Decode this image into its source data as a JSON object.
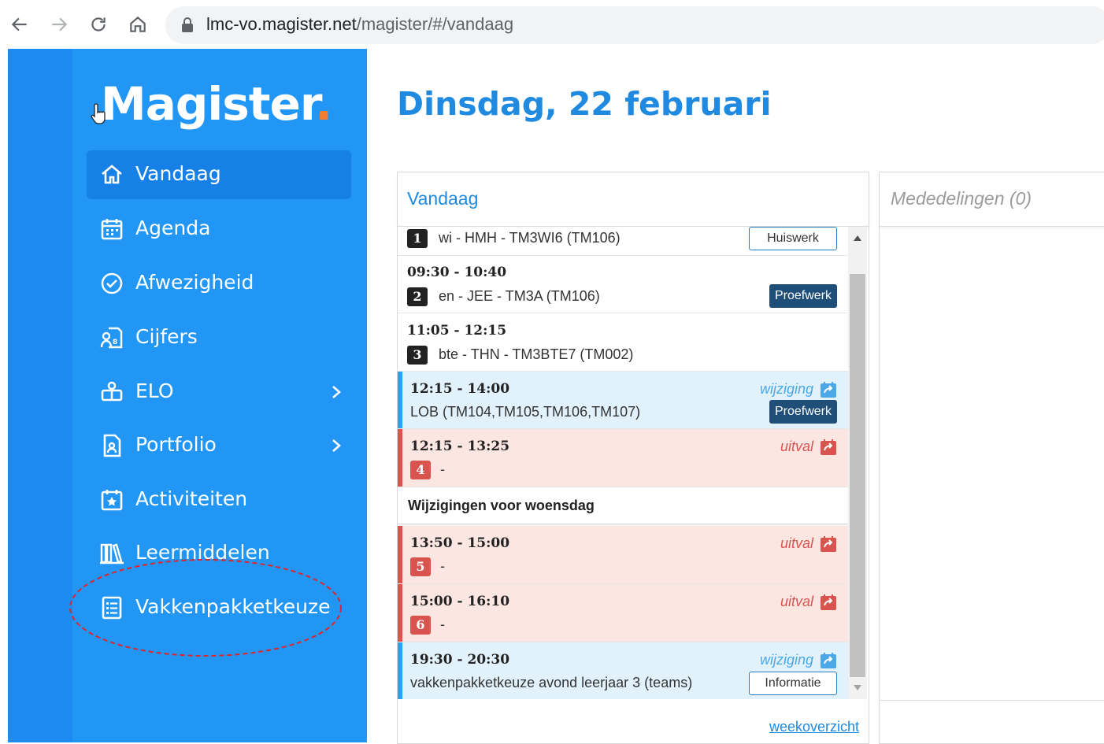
{
  "browser": {
    "url_host": "lmc-vo.magister.net",
    "url_path": "/magister/#/vandaag"
  },
  "app": {
    "logo": "Magister",
    "logo_dot": "."
  },
  "sidebar": {
    "items": [
      {
        "label": "Vandaag",
        "icon": "home-icon",
        "active": true
      },
      {
        "label": "Agenda",
        "icon": "calendar-icon"
      },
      {
        "label": "Afwezigheid",
        "icon": "check-circle-icon"
      },
      {
        "label": "Cijfers",
        "icon": "grades-icon"
      },
      {
        "label": "ELO",
        "icon": "elo-icon",
        "has_submenu": true
      },
      {
        "label": "Portfolio",
        "icon": "portfolio-icon",
        "has_submenu": true
      },
      {
        "label": "Activiteiten",
        "icon": "activity-calendar-icon"
      },
      {
        "label": "Leermiddelen",
        "icon": "books-icon"
      },
      {
        "label": "Vakkenpakketkeuze",
        "icon": "list-icon",
        "highlighted": true
      }
    ]
  },
  "main": {
    "title": "Dinsdag, 22 februari",
    "today_panel": {
      "title": "Vandaag",
      "rows": [
        {
          "num": "1",
          "desc": "wi - HMH - TM3WI6 (TM106)",
          "button": "Huiswerk"
        },
        {
          "time": "09:30 - 10:40",
          "num": "2",
          "desc": "en - JEE - TM3A (TM106)",
          "button": "Proefwerk"
        },
        {
          "time": "11:05 - 12:15",
          "num": "3",
          "desc": "bte - THN - TM3BTE7 (TM002)"
        },
        {
          "time": "12:15 - 14:00",
          "desc": "LOB (TM104,TM105,TM106,TM107)",
          "status": "wijziging",
          "button": "Proefwerk"
        },
        {
          "time": "12:15 - 13:25",
          "num": "4",
          "desc": "-",
          "status": "uitval"
        }
      ],
      "section_label": "Wijzigingen voor woensdag",
      "next_rows": [
        {
          "time": "13:50 - 15:00",
          "num": "5",
          "desc": "-",
          "status": "uitval"
        },
        {
          "time": "15:00 - 16:10",
          "num": "6",
          "desc": "-",
          "status": "uitval"
        },
        {
          "time": "19:30 - 20:30",
          "desc": "vakkenpakketkeuze avond leerjaar 3 (teams)",
          "status": "wijziging",
          "button": "Informatie"
        }
      ],
      "footer_link": "weekoverzicht"
    },
    "announcements_panel": {
      "title": "Mededelingen (0)"
    }
  },
  "colors": {
    "sidebar": "#2196f5",
    "accent": "#1f8ae0",
    "change": "#e2f2fc",
    "cancel": "#fbe6e1",
    "proefwerk": "#1f4e79"
  }
}
